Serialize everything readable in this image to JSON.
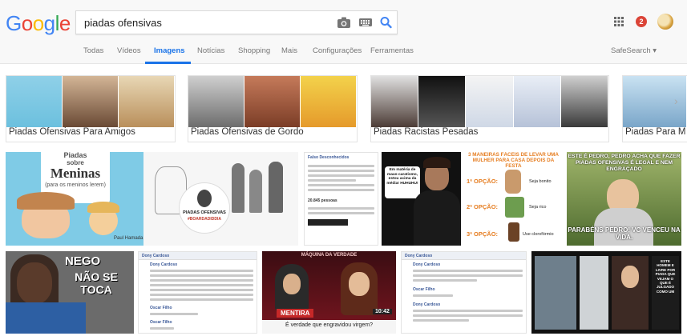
{
  "logo": {
    "letters": [
      "G",
      "o",
      "o",
      "g",
      "l",
      "e"
    ],
    "colors": [
      "#4285F4",
      "#EA4335",
      "#FBBC05",
      "#4285F4",
      "#34A853",
      "#EA4335"
    ]
  },
  "search": {
    "query": "piadas ofensivas"
  },
  "icons": {
    "camera": "camera-icon",
    "keyboard": "keyboard-icon",
    "search": "search-icon",
    "apps": "apps-grid-icon"
  },
  "notifications": {
    "count": "2"
  },
  "tabs": [
    {
      "label": "Todas"
    },
    {
      "label": "Vídeos"
    },
    {
      "label": "Imagens",
      "active": true
    },
    {
      "label": "Notícias"
    },
    {
      "label": "Shopping"
    },
    {
      "label": "Mais"
    },
    {
      "label": "Configurações"
    },
    {
      "label": "Ferramentas"
    }
  ],
  "safesearch": {
    "label": "SafeSearch ▾"
  },
  "related": [
    {
      "label": "Piadas Ofensivas Para Amigos"
    },
    {
      "label": "Piadas Ofensivas de Gordo"
    },
    {
      "label": "Piadas Racistas Pesadas"
    },
    {
      "label": "Piadas Para M"
    }
  ],
  "results": {
    "meninas": {
      "line1": "Piadas",
      "line2": "sobre",
      "line3": "Meninas",
      "line4": "(para os meninos lerem)",
      "credit": "Paul Hamada"
    },
    "sketch": {
      "line1": "PIADAS OFENSIVAS",
      "line2": "#BOARDADIDDIA"
    },
    "fbpost": {
      "author": "Falso Desconhecidos",
      "stat": "20.845 pessoas"
    },
    "materia": {
      "text": "Em matéria de maus-caratismo, estou acima da média! HUHUHU!"
    },
    "maneiras": {
      "title": "3 MANEIRAS FÁCEIS DE LEVAR UMA MULHER PARA CASA DEPOIS DA FESTA",
      "opcao1": "1ª OPÇÃO:",
      "opcao1_text": "Seja bonito",
      "opcao2": "2ª OPÇÃO:",
      "opcao2_text": "Seja rico",
      "opcao3": "3ª OPÇÃO:",
      "opcao3_text": "Use clorofórmio"
    },
    "pedro": {
      "top": "ESTE É PEDRO, PEDRO ACHA QUE FAZER PIADAS OFENSIVAS É LEGAL E NEM ENGRAÇADO",
      "bottom": "PARABÉNS PEDRO! VC VENCEU NA VIDA."
    },
    "nego": {
      "line1": "NEGO",
      "line2": "NÃO SE TOCA"
    },
    "dony1": {
      "header": "Dony Cardoso",
      "name": "Dony Cardoso",
      "reply1": "Oscar Filho",
      "reply2": "Oscar Filho"
    },
    "maquina": {
      "title": "MÁQUINA DA VERDADE",
      "banner": "MENTIRA",
      "question": "É verdade que engravidou virgem?",
      "clock": "10:42"
    },
    "dony2": {
      "header": "Dony Cardoso",
      "name": "Dony Cardoso",
      "reply1": "Oscar Filho",
      "reply2": "Dony Cardoso"
    },
    "lastTile": {
      "text": "ESTE HOMEM E LIVRE POR PIADA QUE VEJAM O QUE É JULGADO COMO UM"
    }
  }
}
